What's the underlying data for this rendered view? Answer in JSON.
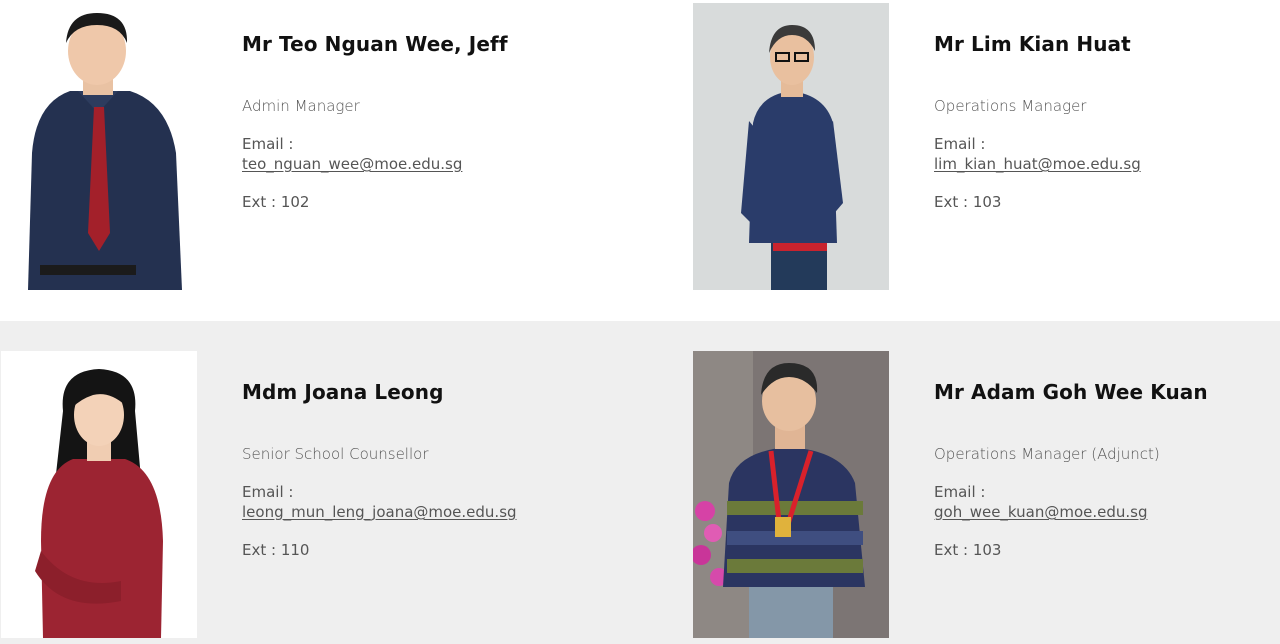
{
  "staff": [
    {
      "name": "Mr Teo Nguan Wee, Jeff",
      "role": "Admin Manager",
      "email_label": "Email :",
      "email": "teo_nguan_wee@moe.edu.sg",
      "ext": "Ext : 102"
    },
    {
      "name": "Mr Lim Kian Huat",
      "role": "Operations Manager",
      "email_label": "Email :",
      "email": "lim_kian_huat@moe.edu.sg",
      "ext": "Ext : 103"
    },
    {
      "name": "Mdm Joana Leong",
      "role": "Senior School Counsellor",
      "email_label": "Email :",
      "email": "leong_mun_leng_joana@moe.edu.sg",
      "ext": "Ext : 110"
    },
    {
      "name": "Mr Adam Goh Wee Kuan",
      "role": "Operations Manager (Adjunct)",
      "email_label": "Email :",
      "email": "goh_wee_kuan@moe.edu.sg",
      "ext": "Ext : 103"
    }
  ],
  "colors": {
    "row1_bg": "#ffffff",
    "row2_bg": "#efefef",
    "name_text": "#111111",
    "body_text": "#555555"
  }
}
